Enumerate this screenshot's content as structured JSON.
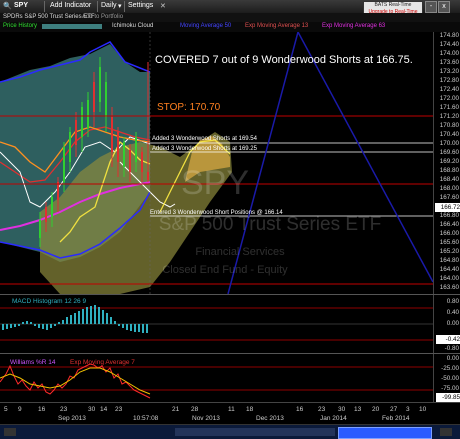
{
  "toolbar": {
    "symbol": "SPY",
    "add_indicator": "Add Indicator",
    "interval": "Daily",
    "settings": "Settings"
  },
  "subheader": {
    "name": "SPDRs S&P 500 Trust Series ETF",
    "add_portfolio": "Add to Portfolio",
    "watermark_ticker": "SPY",
    "watermark_name": "S&P 500 Trust Series ETF",
    "watermark_sector": "Financial Services",
    "watermark_industry": "Closed End Fund - Equity"
  },
  "bats_badge": {
    "line1": "BATS Real-Time",
    "line2": "Upgrade to Real-Time"
  },
  "window_controls": {
    "minimize": "-",
    "close": "x"
  },
  "indicator_bar": {
    "price_history": "Price History",
    "ichimoku": "Ichimoku Cloud",
    "ma": "Moving Average 50",
    "ema13": "Exp Moving Average 13",
    "ema63": "Exp Moving Average 63"
  },
  "annotations": {
    "covered": "COVERED 7 out of 9 Wonderwood Shorts at 166.75.",
    "stop": "STOP: 170.70",
    "added1": "Added 3 Wonderwood Shorts at 169.54",
    "added2": "Added 3 Wonderwood Shorts at 169.25",
    "entered": "Entered 3 Wonderwood Short Positions @ 166.14"
  },
  "price_axis": {
    "ticks": [
      "174.80",
      "174.40",
      "174.00",
      "173.60",
      "173.20",
      "172.80",
      "172.40",
      "172.00",
      "171.60",
      "171.20",
      "170.80",
      "170.40",
      "170.00",
      "169.60",
      "169.20",
      "168.80",
      "168.40",
      "168.00",
      "167.60",
      "167.20",
      "166.80",
      "166.40",
      "166.00",
      "165.60",
      "165.20",
      "164.80",
      "164.40",
      "164.00",
      "163.60",
      "163.20"
    ],
    "current_price": "166.72"
  },
  "macd": {
    "label": "MACD Histogram 12 26 9",
    "ticks": [
      "0.80",
      "0.40",
      "0.00",
      "-0.40",
      "-0.80"
    ],
    "current": "-0.42"
  },
  "williams": {
    "label": "Williams %R 14",
    "ma_label": "Exp Moving Average 7",
    "ticks": [
      "0.00",
      "-25.00",
      "-50.00",
      "-75.00",
      "-100.00"
    ],
    "current": "-99.85"
  },
  "time_axis": {
    "labels": [
      "5",
      "9",
      "16",
      "23",
      "30",
      "Sep 2013",
      "14",
      "23",
      "10:57:08",
      "21",
      "28",
      "Nov 2013",
      "11",
      "18",
      "Dec 2013",
      "16",
      "23",
      "30",
      "Jan 2014",
      "13",
      "20",
      "27",
      "Feb 2014",
      "3",
      "10"
    ]
  },
  "colors": {
    "cloud_teal": "#3e7f7f",
    "cloud_olive": "#8d8a3c",
    "stop_line": "#c00000",
    "projection_line": "#1a1aa8",
    "macd_bars": "#2fb0c0",
    "williams_red": "#ff2a2a",
    "williams_yellow": "#f0c000"
  }
}
